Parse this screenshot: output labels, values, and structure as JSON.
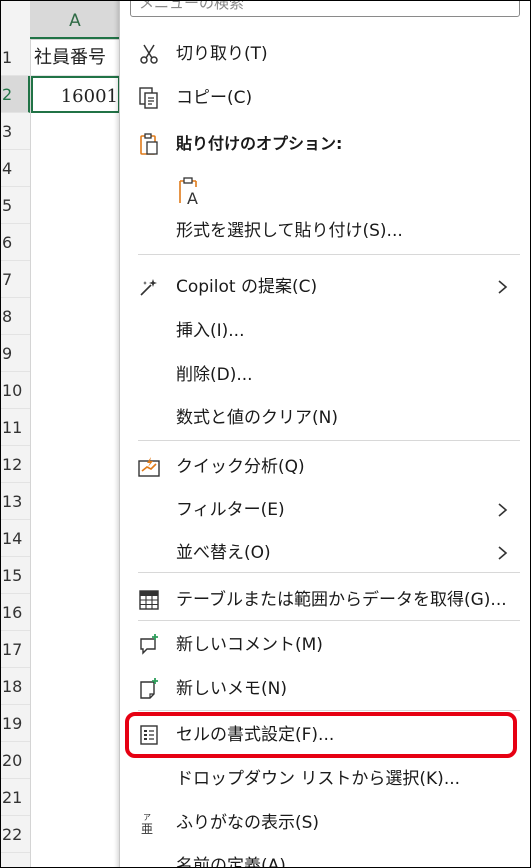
{
  "sheet": {
    "column_header": "A",
    "row_numbers": [
      "1",
      "2",
      "3",
      "4",
      "5",
      "6",
      "7",
      "8",
      "9",
      "10",
      "11",
      "12",
      "13",
      "14",
      "15",
      "16",
      "17",
      "18",
      "19",
      "20",
      "21",
      "22"
    ],
    "cell_a1": "社員番号",
    "cell_a2": "16001"
  },
  "menu": {
    "search_placeholder": "メニューの検索",
    "paste_options_header": "貼り付けのオプション:",
    "items": {
      "cut": "切り取り(T)",
      "copy": "コピー(C)",
      "paste_special": "形式を選択して貼り付け(S)...",
      "copilot": "Copilot の提案(C)",
      "insert": "挿入(I)...",
      "delete": "削除(D)...",
      "clear": "数式と値のクリア(N)",
      "quick_analysis": "クイック分析(Q)",
      "filter": "フィルター(E)",
      "sort": "並べ替え(O)",
      "get_data": "テーブルまたは範囲からデータを取得(G)...",
      "new_comment": "新しいコメント(M)",
      "new_note": "新しいメモ(N)",
      "format_cells": "セルの書式設定(F)...",
      "dropdown": "ドロップダウン リストから選択(K)...",
      "phonetic": "ふりがなの表示(S)",
      "define_name": "名前の定義(A)..."
    },
    "phonetic_icon_text": "ア亜"
  },
  "colors": {
    "excel_green": "#217346",
    "highlight_red": "#e60012",
    "paste_orange": "#e07b1a"
  }
}
